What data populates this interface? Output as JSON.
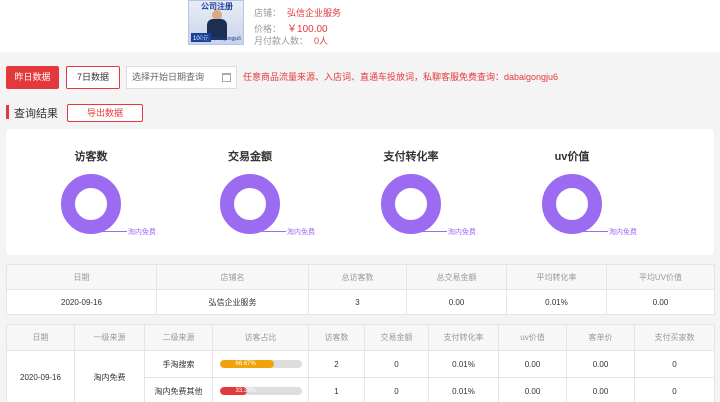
{
  "shop": {
    "thumb_title": "公司注册",
    "thumb_price": "100元",
    "thumb_id": "客服:dabaigongju6",
    "store_label": "店铺：",
    "store_value": "弘信企业服务",
    "price_label": "价格：",
    "price_value": "￥100.00",
    "monthly_label": "月付款人数：",
    "monthly_value": "0人"
  },
  "toolbar": {
    "yesterday_label": "昨日数据",
    "seven_day_label": "7日数据",
    "date_placeholder": "选择开始日期查询",
    "promo_text": "任意商品流量来源、入店词、直通车投放词，私聊客服免费查询：dabaigongju6"
  },
  "results": {
    "title": "查询结果",
    "export_label": "导出数据"
  },
  "metrics": [
    {
      "label": "访客数",
      "legend": "淘内免费",
      "color": "#9b6cf2"
    },
    {
      "label": "交易金额",
      "legend": "淘内免费",
      "color": "#9b6cf2"
    },
    {
      "label": "支付转化率",
      "legend": "淘内免费",
      "color": "#9b6cf2"
    },
    {
      "label": "uv价值",
      "legend": "淘内免费",
      "color": "#9b6cf2"
    }
  ],
  "summary_table": {
    "headers": [
      "日期",
      "店铺名",
      "总访客数",
      "总交易金额",
      "平均转化率",
      "平均UV价值"
    ],
    "row": [
      "2020-09-16",
      "弘信企业服务",
      "3",
      "0.00",
      "0.01%",
      "0.00"
    ]
  },
  "detail_table": {
    "headers": [
      "日期",
      "一级来源",
      "二级来源",
      "访客占比",
      "访客数",
      "交易金额",
      "支付转化率",
      "uv价值",
      "客单价",
      "支付买家数"
    ],
    "date": "2020-09-16",
    "primary_source": "淘内免费",
    "rows": [
      {
        "secondary": "手淘搜索",
        "ratio_text": "66.67%",
        "ratio": 0.6667,
        "bar_color": "#f0a30a",
        "visitors": "2",
        "amount": "0",
        "conversion": "0.01%",
        "uv": "0.00",
        "unit_price": "0.00",
        "buyers": "0"
      },
      {
        "secondary": "淘内免费其他",
        "ratio_text": "33.33%",
        "ratio": 0.3333,
        "bar_color": "#e4393c",
        "visitors": "1",
        "amount": "0",
        "conversion": "0.01%",
        "uv": "0.00",
        "unit_price": "0.00",
        "buyers": "0"
      }
    ]
  }
}
